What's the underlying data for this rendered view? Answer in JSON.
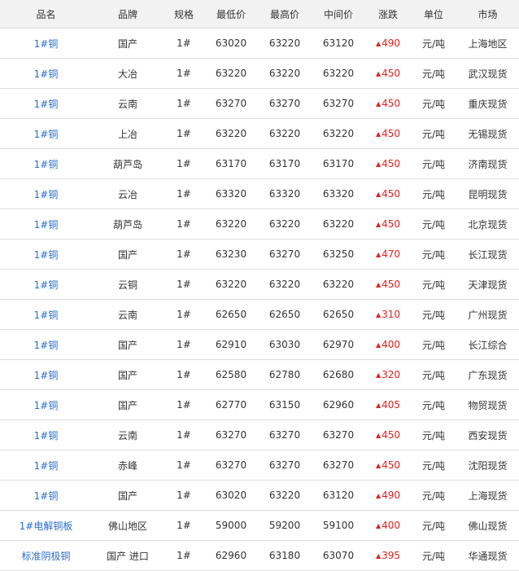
{
  "headers": [
    "品名",
    "品牌",
    "规格",
    "最低价",
    "最高价",
    "中间价",
    "涨跌",
    "单位",
    "市场"
  ],
  "colors": {
    "link": "#2a6fc9",
    "up": "#e02222",
    "header_bg": "#f2f2f2",
    "border": "#dddddd"
  },
  "icons": {
    "change_up": "triangle-up-icon"
  },
  "rows": [
    {
      "name": "1#铜",
      "brand": "国产",
      "spec": "1#",
      "low": "63020",
      "high": "63220",
      "mid": "63120",
      "chg": "490",
      "unit": "元/吨",
      "market": "上海地区"
    },
    {
      "name": "1#铜",
      "brand": "大冶",
      "spec": "1#",
      "low": "63220",
      "high": "63220",
      "mid": "63220",
      "chg": "450",
      "unit": "元/吨",
      "market": "武汉现货"
    },
    {
      "name": "1#铜",
      "brand": "云南",
      "spec": "1#",
      "low": "63270",
      "high": "63270",
      "mid": "63270",
      "chg": "450",
      "unit": "元/吨",
      "market": "重庆现货"
    },
    {
      "name": "1#铜",
      "brand": "上冶",
      "spec": "1#",
      "low": "63220",
      "high": "63220",
      "mid": "63220",
      "chg": "450",
      "unit": "元/吨",
      "market": "无锡现货"
    },
    {
      "name": "1#铜",
      "brand": "葫芦岛",
      "spec": "1#",
      "low": "63170",
      "high": "63170",
      "mid": "63170",
      "chg": "450",
      "unit": "元/吨",
      "market": "济南现货"
    },
    {
      "name": "1#铜",
      "brand": "云冶",
      "spec": "1#",
      "low": "63320",
      "high": "63320",
      "mid": "63320",
      "chg": "450",
      "unit": "元/吨",
      "market": "昆明现货"
    },
    {
      "name": "1#铜",
      "brand": "葫芦岛",
      "spec": "1#",
      "low": "63220",
      "high": "63220",
      "mid": "63220",
      "chg": "450",
      "unit": "元/吨",
      "market": "北京现货"
    },
    {
      "name": "1#铜",
      "brand": "国产",
      "spec": "1#",
      "low": "63230",
      "high": "63270",
      "mid": "63250",
      "chg": "470",
      "unit": "元/吨",
      "market": "长江现货"
    },
    {
      "name": "1#铜",
      "brand": "云铜",
      "spec": "1#",
      "low": "63220",
      "high": "63220",
      "mid": "63220",
      "chg": "450",
      "unit": "元/吨",
      "market": "天津现货"
    },
    {
      "name": "1#铜",
      "brand": "云南",
      "spec": "1#",
      "low": "62650",
      "high": "62650",
      "mid": "62650",
      "chg": "310",
      "unit": "元/吨",
      "market": "广州现货"
    },
    {
      "name": "1#铜",
      "brand": "国产",
      "spec": "1#",
      "low": "62910",
      "high": "63030",
      "mid": "62970",
      "chg": "400",
      "unit": "元/吨",
      "market": "长江综合"
    },
    {
      "name": "1#铜",
      "brand": "国产",
      "spec": "1#",
      "low": "62580",
      "high": "62780",
      "mid": "62680",
      "chg": "320",
      "unit": "元/吨",
      "market": "广东现货"
    },
    {
      "name": "1#铜",
      "brand": "国产",
      "spec": "1#",
      "low": "62770",
      "high": "63150",
      "mid": "62960",
      "chg": "405",
      "unit": "元/吨",
      "market": "物贸现货"
    },
    {
      "name": "1#铜",
      "brand": "云南",
      "spec": "1#",
      "low": "63270",
      "high": "63270",
      "mid": "63270",
      "chg": "450",
      "unit": "元/吨",
      "market": "西安现货"
    },
    {
      "name": "1#铜",
      "brand": "赤峰",
      "spec": "1#",
      "low": "63270",
      "high": "63270",
      "mid": "63270",
      "chg": "450",
      "unit": "元/吨",
      "market": "沈阳现货"
    },
    {
      "name": "1#铜",
      "brand": "国产",
      "spec": "1#",
      "low": "63020",
      "high": "63220",
      "mid": "63120",
      "chg": "490",
      "unit": "元/吨",
      "market": "上海现货"
    },
    {
      "name": "1#电解铜板",
      "brand": "佛山地区",
      "spec": "1#",
      "low": "59000",
      "high": "59200",
      "mid": "59100",
      "chg": "400",
      "unit": "元/吨",
      "market": "佛山现货"
    },
    {
      "name": "标准阴极铜",
      "brand": "国产 进口",
      "spec": "1#",
      "low": "62960",
      "high": "63180",
      "mid": "63070",
      "chg": "395",
      "unit": "元/吨",
      "market": "华通现货"
    }
  ]
}
